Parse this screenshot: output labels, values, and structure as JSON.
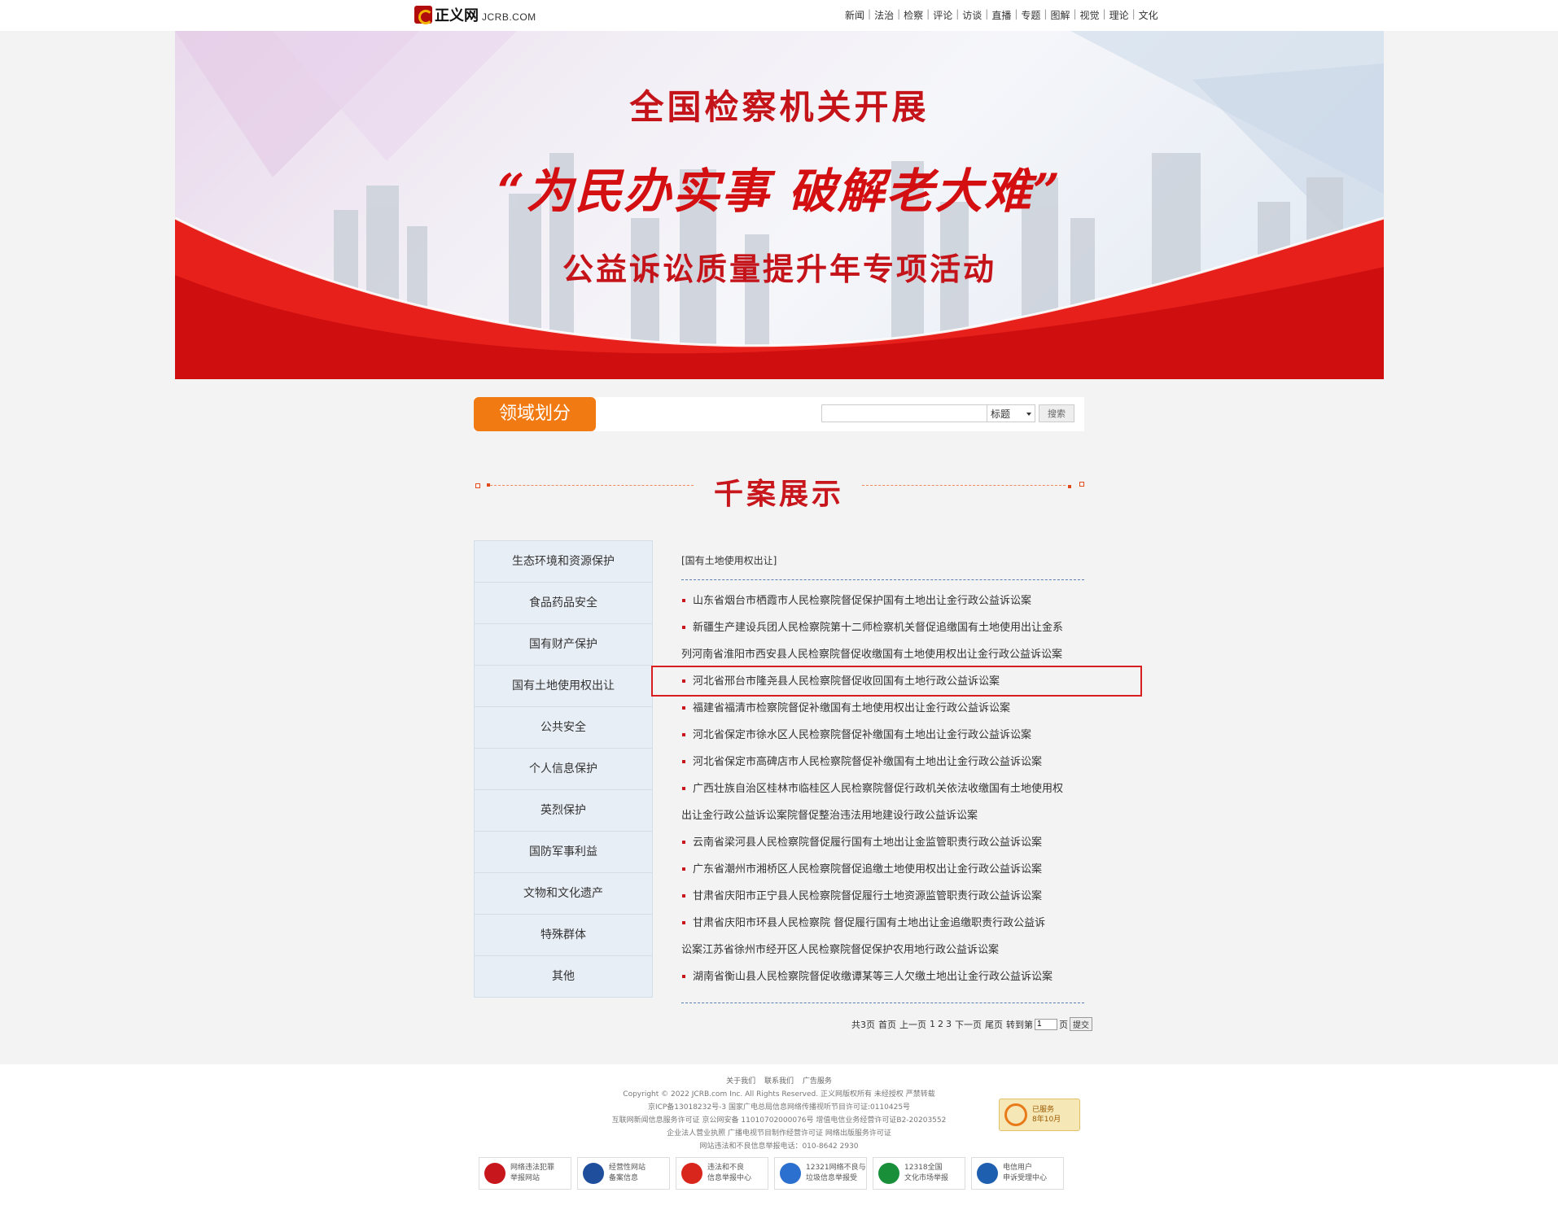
{
  "site": {
    "logo_cn": "正义网",
    "logo_en": "JCRB.COM",
    "nav": [
      "新闻",
      "法治",
      "检察",
      "评论",
      "访谈",
      "直播",
      "专题",
      "图解",
      "视觉",
      "理论",
      "文化"
    ]
  },
  "banner": {
    "line1": "全国检察机关开展",
    "line2": "“为民办实事  破解老大难”",
    "line3": "公益诉讼质量提升年专项活动"
  },
  "toolbar": {
    "domain_label": "领域划分",
    "search_placeholder": "",
    "select_value": "标题",
    "search_button": "搜索"
  },
  "section_title": "千案展示",
  "sidebar": [
    "生态环境和资源保护",
    "食品药品安全",
    "国有财产保护",
    "国有土地使用权出让",
    "公共安全",
    "个人信息保护",
    "英烈保护",
    "国防军事利益",
    "文物和文化遗产",
    "特殊群体",
    "其他"
  ],
  "category_label": "[国有土地使用权出让]",
  "cases": [
    "山东省烟台市栖霞市人民检察院督促保护国有土地出让金行政公益诉讼案",
    "新疆生产建设兵团人民检察院第十二师检察机关督促追缴国有土地使用出让金系",
    "列河南省淮阳市西安县人民检察院督促收缴国有土地使用权出让金行政公益诉讼案",
    "河北省邢台市隆尧县人民检察院督促收回国有土地行政公益诉讼案",
    "福建省福清市检察院督促补缴国有土地使用权出让金行政公益诉讼案",
    "河北省保定市徐水区人民检察院督促补缴国有土地出让金行政公益诉讼案",
    "河北省保定市高碑店市人民检察院督促补缴国有土地出让金行政公益诉讼案",
    "广西壮族自治区桂林市临桂区人民检察院督促行政机关依法收缴国有土地使用权",
    "出让金行政公益诉讼案院督促整治违法用地建设行政公益诉讼案",
    "云南省梁河县人民检察院督促履行国有土地出让金监管职责行政公益诉讼案",
    "广东省潮州市湘桥区人民检察院督促追缴土地使用权出让金行政公益诉讼案",
    "甘肃省庆阳市正宁县人民检察院督促履行土地资源监管职责行政公益诉讼案",
    "甘肃省庆阳市环县人民检察院  督促履行国有土地出让金追缴职责行政公益诉",
    "讼案江苏省徐州市经开区人民检察院督促保护农用地行政公益诉讼案",
    "湖南省衡山县人民检察院督促收缴谭某等三人欠缴土地出让金行政公益诉讼案"
  ],
  "pager": {
    "total": "共3页",
    "first": "首页",
    "prev": "上一页",
    "pages": [
      "1",
      "2",
      "3"
    ],
    "next": "下一页",
    "last": "尾页",
    "goto_label": "转到第",
    "goto_value": "1",
    "page_unit": "页",
    "submit": "提交"
  },
  "footer": {
    "links": [
      "关于我们",
      "联系我们",
      "广告服务"
    ],
    "lines": [
      "Copyright © 2022 JCRB.com Inc. All Rights Reserved.  正义网版权所有  未经授权  严禁转载",
      "京ICP备13018232号-3   国家广电总局信息网络传播视听节目许可证:0110425号",
      "互联网新闻信息服务许可证   京公网安备 11010702000076号   增值电信业务经营许可证B2-20203552",
      "企业法人营业执照   广播电视节目制作经营许可证   网络出版服务许可证",
      "网站违法和不良信息举报电话：010-8642 2930"
    ],
    "badge_line1": "已服务",
    "badge_line2": "8年10月",
    "badges": [
      {
        "l1": "网络违法犯罪",
        "l2": "举报网站",
        "color": "#c8161d"
      },
      {
        "l1": "经营性网站",
        "l2": "备案信息",
        "color": "#1f4f9c"
      },
      {
        "l1": "违法和不良",
        "l2": "信息举报中心",
        "color": "#d8261c"
      },
      {
        "l1": "12321网络不良与",
        "l2": "垃圾信息举报受",
        "color": "#2b6fcf"
      },
      {
        "l1": "12318全国",
        "l2": "文化市场举报",
        "color": "#1a8f3a"
      },
      {
        "l1": "电信用户",
        "l2": "申诉受理中心",
        "color": "#1e5fb0"
      }
    ]
  }
}
